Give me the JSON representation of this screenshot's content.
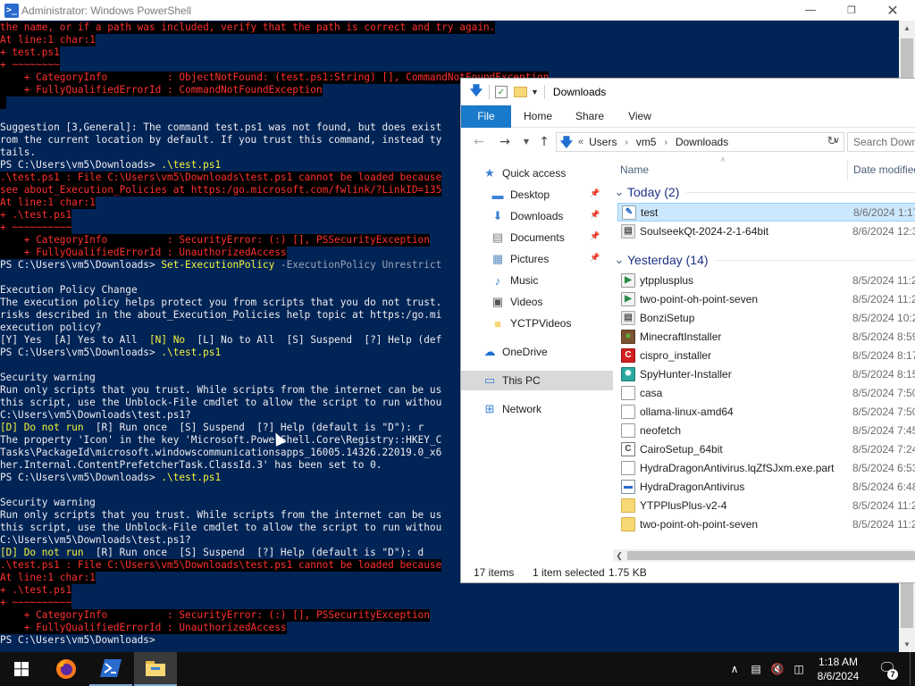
{
  "powershell": {
    "title": "Administrator: Windows PowerShell",
    "lines": [
      {
        "t": "the name, or if a path was included, verify that the path is correct and try again.",
        "c": "err"
      },
      {
        "t": "At line:1 char:1",
        "c": "err"
      },
      {
        "t": "+ test.ps1",
        "c": "err"
      },
      {
        "t": "+ ~~~~~~~~",
        "c": "err"
      },
      {
        "t": "    + CategoryInfo          : ObjectNotFound: (test.ps1:String) [], CommandNotFoundException",
        "c": "err"
      },
      {
        "t": "    + FullyQualifiedErrorId : CommandNotFoundException",
        "c": "err"
      },
      {
        "t": " ",
        "c": "err"
      },
      {
        "t": "",
        "c": "white"
      },
      {
        "t": "Suggestion [3,General]: The command test.ps1 was not found, but does exist",
        "c": "white"
      },
      {
        "t": "rom the current location by default. If you trust this command, instead ty",
        "c": "white"
      },
      {
        "t": "tails.",
        "c": "white"
      },
      {
        "t": "PS C:\\Users\\vm5\\Downloads> .\\test.ps1",
        "c": "cmd"
      },
      {
        "t": ".\\test.ps1 : File C:\\Users\\vm5\\Downloads\\test.ps1 cannot be loaded because",
        "c": "err"
      },
      {
        "t": "see about_Execution_Policies at https:/go.microsoft.com/fwlink/?LinkID=135",
        "c": "err"
      },
      {
        "t": "At line:1 char:1",
        "c": "err"
      },
      {
        "t": "+ .\\test.ps1",
        "c": "err"
      },
      {
        "t": "+ ~~~~~~~~~~",
        "c": "err"
      },
      {
        "t": "    + CategoryInfo          : SecurityError: (:) [], PSSecurityException",
        "c": "err"
      },
      {
        "t": "    + FullyQualifiedErrorId : UnauthorizedAccess",
        "c": "err"
      },
      {
        "t": "PS C:\\Users\\vm5\\Downloads> Set-ExecutionPolicy -ExecutionPolicy Unrestrict",
        "c": "cmd"
      },
      {
        "t": "",
        "c": "white"
      },
      {
        "t": "Execution Policy Change",
        "c": "white"
      },
      {
        "t": "The execution policy helps protect you from scripts that you do not trust.",
        "c": "white"
      },
      {
        "t": "risks described in the about_Execution_Policies help topic at https:/go.mi",
        "c": "white"
      },
      {
        "t": "execution policy?",
        "c": "white"
      },
      {
        "t": "[Y] Yes  [A] Yes to All  [N] No  [L] No to All  [S] Suspend  [?] Help (def",
        "c": "white"
      },
      {
        "t": "PS C:\\Users\\vm5\\Downloads> .\\test.ps1",
        "c": "cmd"
      },
      {
        "t": "",
        "c": "white"
      },
      {
        "t": "Security warning",
        "c": "white"
      },
      {
        "t": "Run only scripts that you trust. While scripts from the internet can be us",
        "c": "white"
      },
      {
        "t": "this script, use the Unblock-File cmdlet to allow the script to run withou",
        "c": "white"
      },
      {
        "t": "C:\\Users\\vm5\\Downloads\\test.ps1?",
        "c": "white"
      },
      {
        "t": "[D] Do not run  [R] Run once  [S] Suspend  [?] Help (default is \"D\"): r",
        "c": "white"
      },
      {
        "t": "The property 'Icon' in the key 'Microsoft.PowerShell.Core\\Registry::HKEY_C",
        "c": "white"
      },
      {
        "t": "Tasks\\PackageId\\microsoft.windowscommunicationsapps_16005.14326.22019.0_x6",
        "c": "white"
      },
      {
        "t": "her.Internal.ContentPrefetcherTask.ClassId.3' has been set to 0.",
        "c": "white"
      },
      {
        "t": "PS C:\\Users\\vm5\\Downloads> .\\test.ps1",
        "c": "cmd"
      },
      {
        "t": "",
        "c": "white"
      },
      {
        "t": "Security warning",
        "c": "white"
      },
      {
        "t": "Run only scripts that you trust. While scripts from the internet can be us",
        "c": "white"
      },
      {
        "t": "this script, use the Unblock-File cmdlet to allow the script to run withou",
        "c": "white"
      },
      {
        "t": "C:\\Users\\vm5\\Downloads\\test.ps1?",
        "c": "white"
      },
      {
        "t": "[D] Do not run  [R] Run once  [S] Suspend  [?] Help (default is \"D\"): d",
        "c": "white"
      },
      {
        "t": ".\\test.ps1 : File C:\\Users\\vm5\\Downloads\\test.ps1 cannot be loaded because",
        "c": "err"
      },
      {
        "t": "At line:1 char:1",
        "c": "err"
      },
      {
        "t": "+ .\\test.ps1",
        "c": "err"
      },
      {
        "t": "+ ~~~~~~~~~~",
        "c": "err"
      },
      {
        "t": "    + CategoryInfo          : SecurityError: (:) [], PSSecurityException",
        "c": "err"
      },
      {
        "t": "    + FullyQualifiedErrorId : UnauthorizedAccess",
        "c": "err"
      },
      {
        "t": "PS C:\\Users\\vm5\\Downloads> ",
        "c": "cmd"
      }
    ],
    "colors": {
      "background": "#012456",
      "error_fg": "#ff3030",
      "error_bg": "#000000",
      "prompt_yellow": "#f4f43c"
    }
  },
  "explorer": {
    "title": "Downloads",
    "ribbon_tabs": [
      "File",
      "Home",
      "Share",
      "View"
    ],
    "breadcrumb": [
      "Users",
      "vm5",
      "Downloads"
    ],
    "breadcrumb_prefix": "«",
    "search_placeholder": "Search Down",
    "nav": [
      {
        "label": "Quick access",
        "icon": "star-icon",
        "pinned": false
      },
      {
        "label": "Desktop",
        "icon": "desktop-folder-icon",
        "pinned": true
      },
      {
        "label": "Downloads",
        "icon": "download-folder-icon",
        "pinned": true
      },
      {
        "label": "Documents",
        "icon": "documents-folder-icon",
        "pinned": true
      },
      {
        "label": "Pictures",
        "icon": "pictures-folder-icon",
        "pinned": true
      },
      {
        "label": "Music",
        "icon": "music-folder-icon",
        "pinned": false
      },
      {
        "label": "Videos",
        "icon": "videos-folder-icon",
        "pinned": false
      },
      {
        "label": "YCTPVideos",
        "icon": "folder-icon",
        "pinned": false
      },
      {
        "label": "OneDrive",
        "icon": "onedrive-icon",
        "pinned": false
      },
      {
        "label": "This PC",
        "icon": "this-pc-icon",
        "pinned": false,
        "selected": true
      },
      {
        "label": "Network",
        "icon": "network-icon",
        "pinned": false
      }
    ],
    "columns": {
      "name": "Name",
      "date": "Date modified"
    },
    "groups": [
      {
        "label": "Today (2)",
        "files": [
          {
            "name": "test",
            "date": "8/6/2024 1:17",
            "icon": "script-file-icon",
            "selected": true
          },
          {
            "name": "SoulseekQt-2024-2-1-64bit",
            "date": "8/6/2024 12:3",
            "icon": "installer-icon"
          }
        ]
      },
      {
        "label": "Yesterday (14)",
        "files": [
          {
            "name": "ytpplusplus",
            "date": "8/5/2024 11:2",
            "icon": "app-file-icon"
          },
          {
            "name": "two-point-oh-point-seven",
            "date": "8/5/2024 11:2",
            "icon": "app-file-icon"
          },
          {
            "name": "BonziSetup",
            "date": "8/5/2024 10:2",
            "icon": "installer-icon"
          },
          {
            "name": "MinecraftInstaller",
            "date": "8/5/2024 8:59",
            "icon": "minecraft-icon"
          },
          {
            "name": "cispro_installer",
            "date": "8/5/2024 8:17",
            "icon": "comodo-icon"
          },
          {
            "name": "SpyHunter-Installer",
            "date": "8/5/2024 8:15",
            "icon": "spyhunter-icon"
          },
          {
            "name": "casa",
            "date": "8/5/2024 7:50",
            "icon": "blank-file-icon"
          },
          {
            "name": "ollama-linux-amd64",
            "date": "8/5/2024 7:50",
            "icon": "blank-file-icon"
          },
          {
            "name": "neofetch",
            "date": "8/5/2024 7:45",
            "icon": "blank-file-icon"
          },
          {
            "name": "CairoSetup_64bit",
            "date": "8/5/2024 7:24",
            "icon": "cairo-icon"
          },
          {
            "name": "HydraDragonAntivirus.lqZfSJxm.exe.part",
            "date": "8/5/2024 6:53",
            "icon": "blank-file-icon"
          },
          {
            "name": "HydraDragonAntivirus",
            "date": "8/5/2024 6:48",
            "icon": "app-window-icon"
          },
          {
            "name": "YTPPlusPlus-v2-4",
            "date": "8/5/2024 11:2",
            "icon": "folder-icon"
          },
          {
            "name": "two-point-oh-point-seven",
            "date": "8/5/2024 11:2",
            "icon": "folder-icon"
          }
        ]
      }
    ],
    "status": {
      "items": "17 items",
      "selected": "1 item selected",
      "size": "1.75 KB"
    }
  },
  "taskbar": {
    "apps": [
      "Firefox",
      "Windows PowerShell",
      "File Explorer"
    ],
    "time": "1:18 AM",
    "date": "8/6/2024",
    "notifications": "7"
  }
}
